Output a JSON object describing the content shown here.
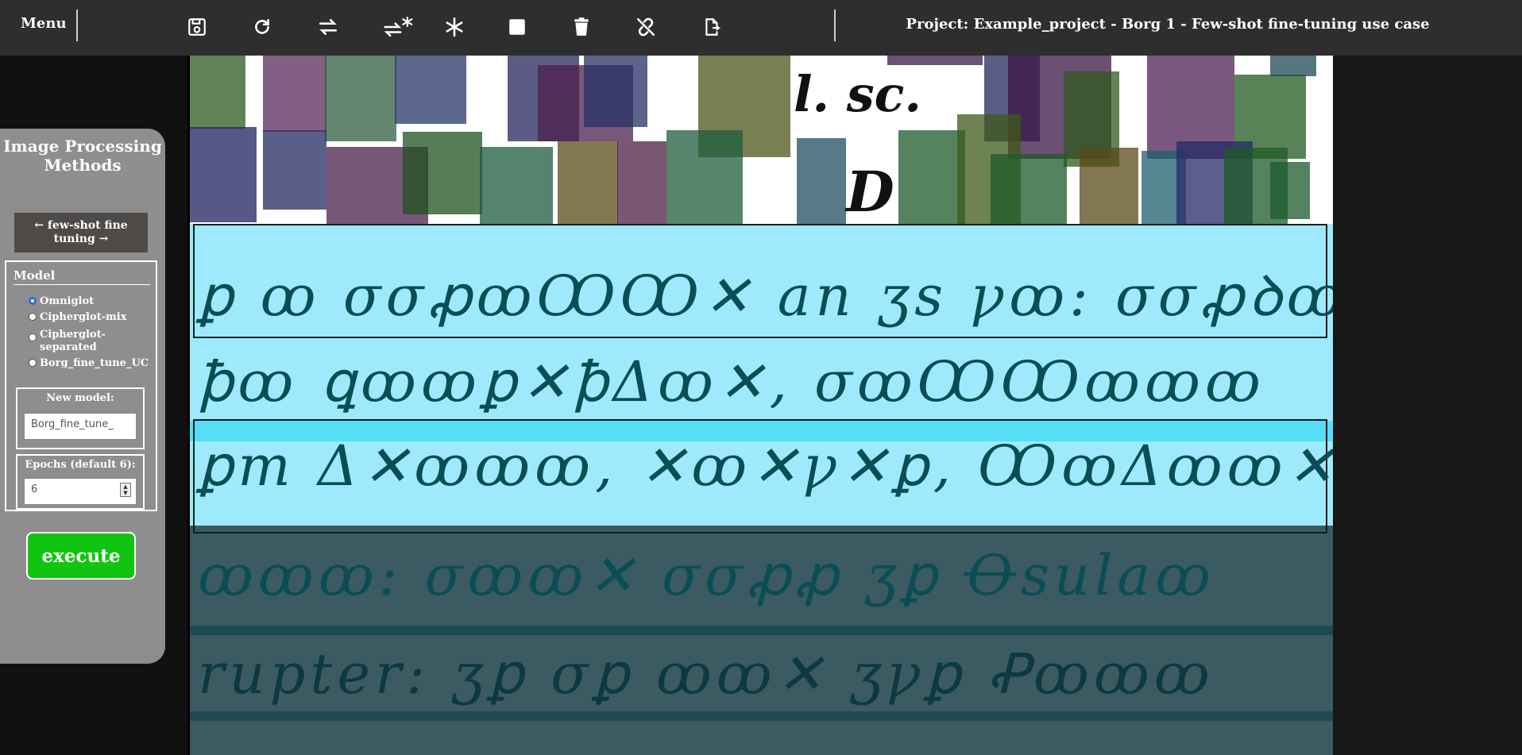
{
  "topbar": {
    "menu_label": "Menu",
    "project_title": "Project: Example_project - Borg 1 - Few-shot fine-tuning use case",
    "tools": [
      "save-icon",
      "redo-icon",
      "swap-icon",
      "swap-freeze-icon",
      "snowflake-icon",
      "square-icon",
      "trash-icon",
      "unlink-icon",
      "export-icon"
    ]
  },
  "panel": {
    "title": "Image Processing Methods",
    "nav_label": "← few-shot fine tuning →",
    "model_legend": "Model",
    "models": [
      "Omniglot",
      "Cipherglot-mix",
      "Cipherglot-separated",
      "Borg_fine_tune_UC"
    ],
    "selected_model": "Omniglot",
    "new_model_label": "New model:",
    "new_model_value": "Borg_fine_tune_",
    "epochs_label": "Epochs (default 6):",
    "epochs_value": "6",
    "execute_label": "execute"
  },
  "document": {
    "header_text_1": "l. sc.",
    "header_text_2": "D",
    "lines": [
      "ꝑ ꝏ  σσꝓꝏꝎꝎ✕  an ʒs ꝩꝏ: σσꝓꝺꝏꝐ✕",
      "ꝥꝏ  ꝗꝏꝏꝑ✕ꝥΔꝏ✕, σꝏꝎꝎꝏꝏꝏ",
      "ꝑm Δ✕ꝏꝏꝏ, ✕ꝏ✕ꝩ✕ꝑ, ꝎꝏΔꝏꝏ✕",
      "ꝏꝏꝏ:  σꝏꝏ✕  σσꝓꝓ ʒꝑ Ꝋsulaꝏ",
      "rupter: ʒꝑ  σꝑ  ꝏꝏ✕ ʒꝩꝑ Ꝓꝏꝏꝏ"
    ]
  }
}
